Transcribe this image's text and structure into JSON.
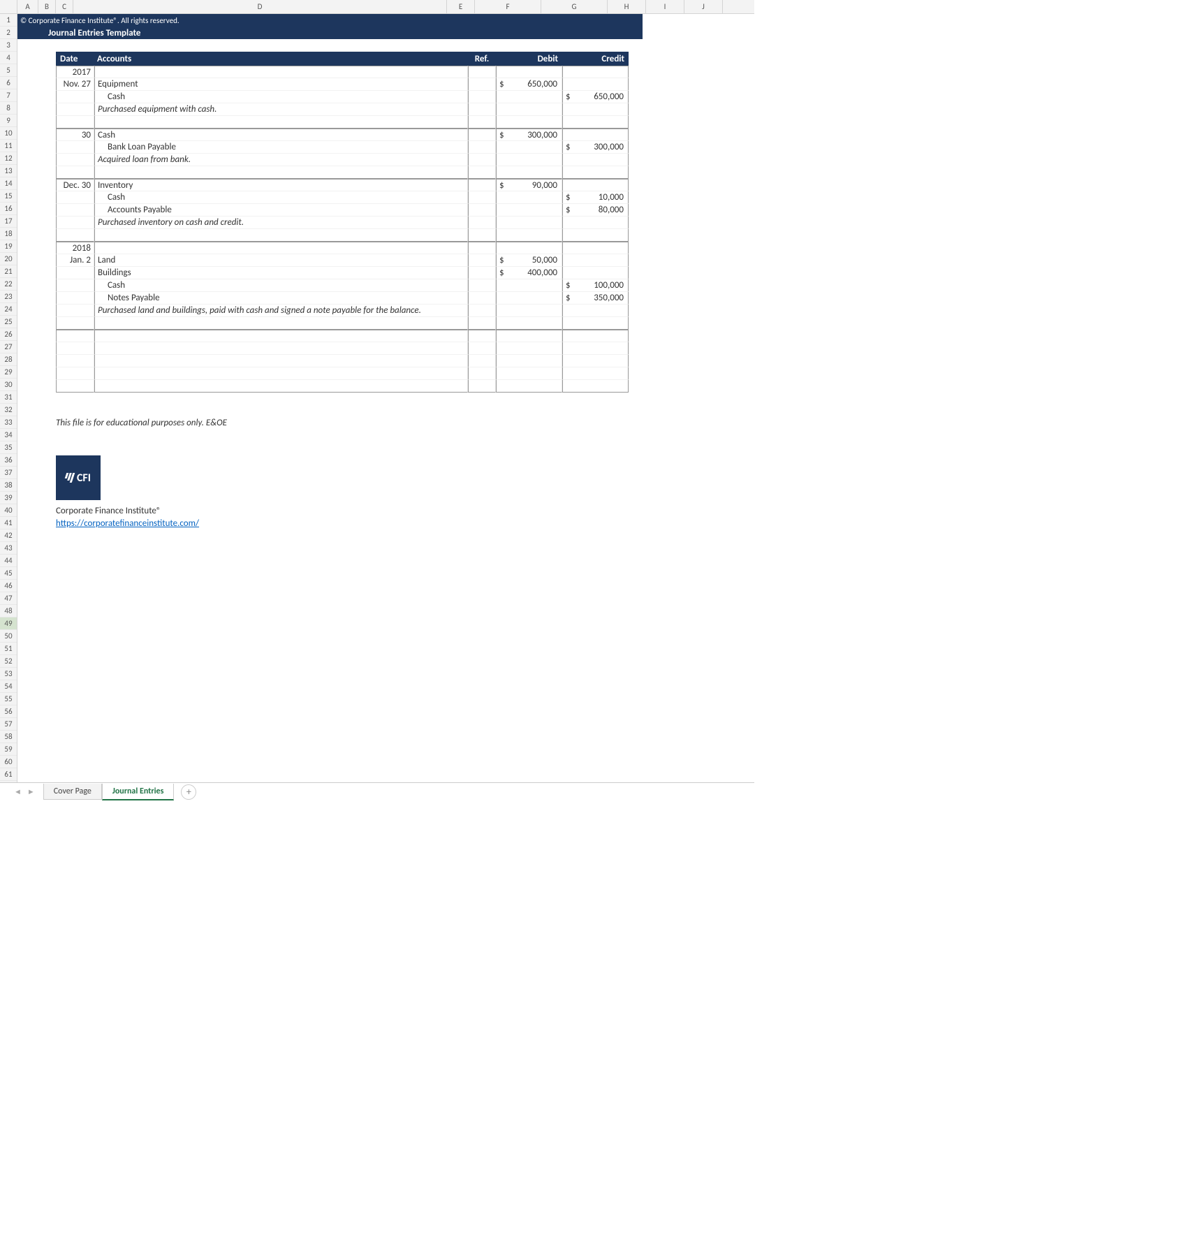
{
  "cols": [
    "A",
    "B",
    "C",
    "D",
    "E",
    "F",
    "G",
    "H",
    "I",
    "J"
  ],
  "copyright": "© Corporate Finance Institute®. All rights reserved.",
  "title": "Journal Entries Template",
  "headers": {
    "date": "Date",
    "accounts": "Accounts",
    "ref": "Ref.",
    "debit": "Debit",
    "credit": "Credit"
  },
  "years": {
    "y2017": "2017",
    "y2018": "2018"
  },
  "entries": {
    "e1": {
      "date_month": "Nov.",
      "date_day": "27",
      "lines": [
        {
          "acc": "Equipment",
          "deb_sym": "$",
          "deb": "650,000",
          "cre_sym": "",
          "cre": ""
        },
        {
          "acc": "Cash",
          "deb_sym": "",
          "deb": "",
          "cre_sym": "$",
          "cre": "650,000"
        }
      ],
      "desc": "Purchased equipment with cash."
    },
    "e2": {
      "date_month": "",
      "date_day": "30",
      "lines": [
        {
          "acc": "Cash",
          "deb_sym": "$",
          "deb": "300,000",
          "cre_sym": "",
          "cre": ""
        },
        {
          "acc": "Bank Loan Payable",
          "deb_sym": "",
          "deb": "",
          "cre_sym": "$",
          "cre": "300,000"
        }
      ],
      "desc": "Acquired loan from bank."
    },
    "e3": {
      "date_month": "Dec.",
      "date_day": "30",
      "lines": [
        {
          "acc": "Inventory",
          "deb_sym": "$",
          "deb": "90,000",
          "cre_sym": "",
          "cre": ""
        },
        {
          "acc": "Cash",
          "deb_sym": "",
          "deb": "",
          "cre_sym": "$",
          "cre": "10,000"
        },
        {
          "acc": "Accounts Payable",
          "deb_sym": "",
          "deb": "",
          "cre_sym": "$",
          "cre": "80,000"
        }
      ],
      "desc": "Purchased inventory on cash and credit."
    },
    "e4": {
      "date_month": "Jan.",
      "date_day": "2",
      "lines": [
        {
          "acc": "Land",
          "deb_sym": "$",
          "deb": "50,000",
          "cre_sym": "",
          "cre": ""
        },
        {
          "acc": "Buildings",
          "deb_sym": "$",
          "deb": "400,000",
          "cre_sym": "",
          "cre": ""
        },
        {
          "acc": "Cash",
          "deb_sym": "",
          "deb": "",
          "cre_sym": "$",
          "cre": "100,000"
        },
        {
          "acc": "Notes Payable",
          "deb_sym": "",
          "deb": "",
          "cre_sym": "$",
          "cre": "350,000"
        }
      ],
      "desc": "Purchased land and buildings, paid with cash and signed a note payable for the balance."
    }
  },
  "disclaimer": "This file is for educational purposes only. E&OE",
  "logo_text": "CFI",
  "company": "Corporate Finance Institute®",
  "url": "https://corporatefinanceinstitute.com/",
  "tabs": {
    "t1": "Cover Page",
    "t2": "Journal Entries"
  },
  "selected_row": "49"
}
